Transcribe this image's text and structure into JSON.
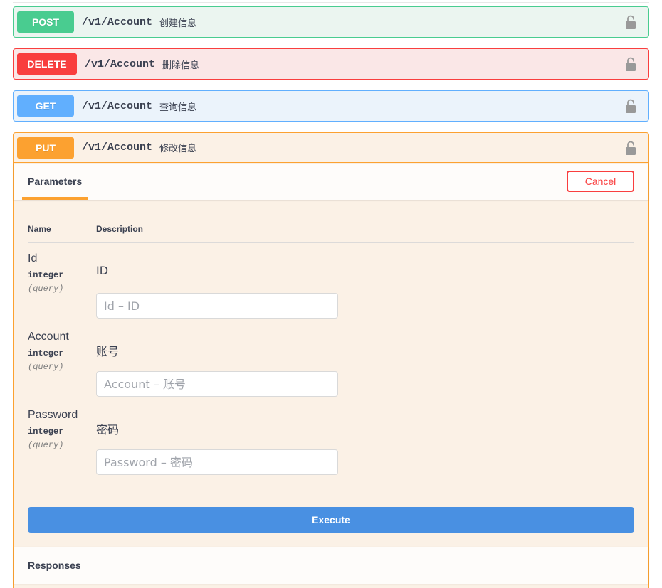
{
  "operations": [
    {
      "method": "POST",
      "path": "/v1/Account",
      "summary": "创建信息",
      "color": "#49cc90"
    },
    {
      "method": "DELETE",
      "path": "/v1/Account",
      "summary": "删除信息",
      "color": "#f93e3e"
    },
    {
      "method": "GET",
      "path": "/v1/Account",
      "summary": "查询信息",
      "color": "#61affe"
    },
    {
      "method": "PUT",
      "path": "/v1/Account",
      "summary": "修改信息",
      "color": "#fca130"
    }
  ],
  "lock_icon": "unlock-icon",
  "put_panel": {
    "tab_label": "Parameters",
    "cancel_label": "Cancel",
    "columns": {
      "name": "Name",
      "description": "Description"
    },
    "params": [
      {
        "name": "Id",
        "type": "integer",
        "in": "(query)",
        "description": "ID",
        "placeholder": "Id – ID"
      },
      {
        "name": "Account",
        "type": "integer",
        "in": "(query)",
        "description": "账号",
        "placeholder": "Account – 账号"
      },
      {
        "name": "Password",
        "type": "integer",
        "in": "(query)",
        "description": "密码",
        "placeholder": "Password – 密码"
      }
    ],
    "execute_label": "Execute",
    "responses_label": "Responses"
  }
}
